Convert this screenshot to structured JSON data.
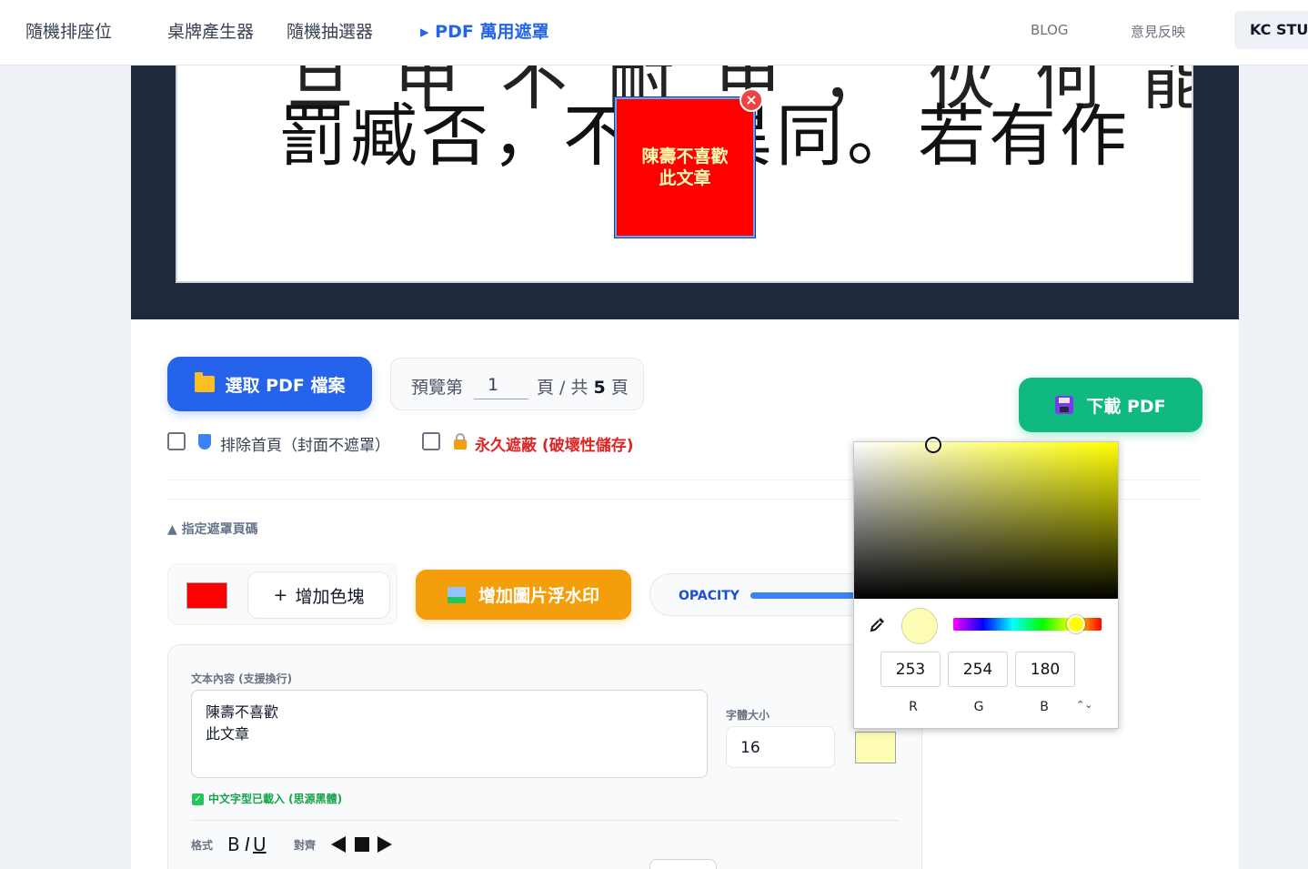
{
  "nav": {
    "items": [
      {
        "label": "隨機排座位"
      },
      {
        "label": "桌牌產生器"
      },
      {
        "label": "隨機抽選器"
      },
      {
        "label": "▸ PDF 萬用遮罩"
      }
    ],
    "right": [
      {
        "label": "BLOG"
      },
      {
        "label": "意見反映"
      }
    ],
    "brand": "KC STUD"
  },
  "document": {
    "line1": "旦 甲 不 耐 甲 ， 伙 何   能 ，  ",
    "line2": "罰臧否，不宜異同。若有作"
  },
  "mask": {
    "text": "陳壽不喜歡\n此文章",
    "bg_color": "#ff0000",
    "text_color": "#fdfeb4",
    "close": "×"
  },
  "controls": {
    "select_pdf_label": "選取 PDF 檔案",
    "preview_prefix": "預覽第",
    "current_page": "1",
    "page_suffix": "頁 / 共",
    "total_pages": "5",
    "page_unit": "頁",
    "download_label": "下載 PDF",
    "exclude_first_label": "排除首頁（封面不遮罩）",
    "permanent_label": "永久遮蔽 (破壞性儲存)",
    "section_toggle": "▲ 指定遮罩頁碼",
    "add_block_label": "增加色塊",
    "add_block_icon": "+",
    "add_image_label": "增加圖片浮水印",
    "opacity_label": "OPACITY",
    "block_color": "#ff0000"
  },
  "text_editor": {
    "content_label": "文本內容 (支援換行)",
    "content": "陳壽不喜歡\n此文章",
    "size_label": "字體大小",
    "font_size": "16",
    "text_color": "#fdfeb4",
    "font_status": "中文字型已載入 (思源黑體)",
    "format_label": "格式",
    "bold": "B",
    "italic": "I",
    "underline": "U",
    "align_label": "對齊"
  },
  "color_picker": {
    "hue_color": "#ffff00",
    "current_color": "#fdfeb4",
    "r": "253",
    "g": "254",
    "b": "180",
    "r_label": "R",
    "g_label": "G",
    "b_label": "B",
    "mode_toggle": "⌃⌄"
  }
}
